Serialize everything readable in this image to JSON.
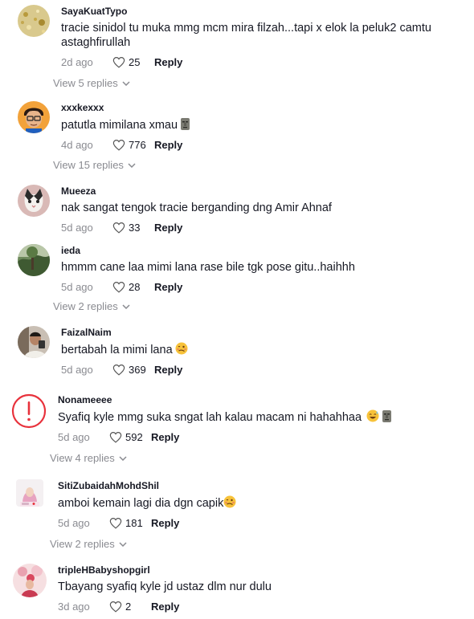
{
  "comments": [
    {
      "username": "SayaKuatTypo",
      "text": "tracie sinidol tu muka mmg mcm mira filzah...tapi x elok la peluk2 camtu astaghfirullah",
      "time": "2d ago",
      "likes": "25",
      "reply": "Reply",
      "view_replies": "View 5 replies",
      "avatar": "gold-glitter-avatar"
    },
    {
      "username": "xxxkexxx",
      "text": "patutla mimilana xmau",
      "time": "4d ago",
      "likes": "776",
      "reply": "Reply",
      "view_replies": "View 15 replies",
      "avatar": "cartoon-boy-avatar",
      "emojis": [
        "moai-emoji"
      ]
    },
    {
      "username": "Mueeza",
      "text": "nak sangat tengok tracie berganding dng Amir Ahnaf",
      "time": "5d ago",
      "likes": "33",
      "reply": "Reply",
      "avatar": "cat-avatar"
    },
    {
      "username": "ieda",
      "text": "hmmm cane laa mimi lana rase bile tgk pose gitu..haihhh",
      "time": "5d ago",
      "likes": "28",
      "reply": "Reply",
      "view_replies": "View 2 replies",
      "avatar": "nature-avatar"
    },
    {
      "username": "FaizalNaim",
      "text": "bertabah la mimi lana",
      "time": "5d ago",
      "likes": "369",
      "reply": "Reply",
      "avatar": "person-avatar",
      "emojis": [
        "woozy-face-emoji"
      ]
    },
    {
      "username": "Nonameeee",
      "text": "Syafiq kyle mmg suka sngat lah kalau macam ni hahahhaa",
      "time": "5d ago",
      "likes": "592",
      "reply": "Reply",
      "view_replies": "View 4 replies",
      "avatar": "alert-avatar",
      "emojis": [
        "sweat-smile-emoji",
        "moai-emoji"
      ]
    },
    {
      "username": "SitiZubaidahMohdShil",
      "text": "amboi kemain lagi dia dgn capik",
      "time": "5d ago",
      "likes": "181",
      "reply": "Reply",
      "view_replies": "View 2 replies",
      "avatar": "hijab-avatar",
      "emojis": [
        "woozy-face-emoji"
      ]
    },
    {
      "username": "tripleHBabyshopgirl",
      "text": "Tbayang syafiq kyle jd ustaz dlm nur dulu",
      "time": "3d ago",
      "likes": "2",
      "reply": "Reply",
      "avatar": "pink-balloon-avatar"
    }
  ],
  "colors": {
    "muted": "#8a8b91",
    "text": "#161823",
    "alert_red": "#e8323c"
  }
}
